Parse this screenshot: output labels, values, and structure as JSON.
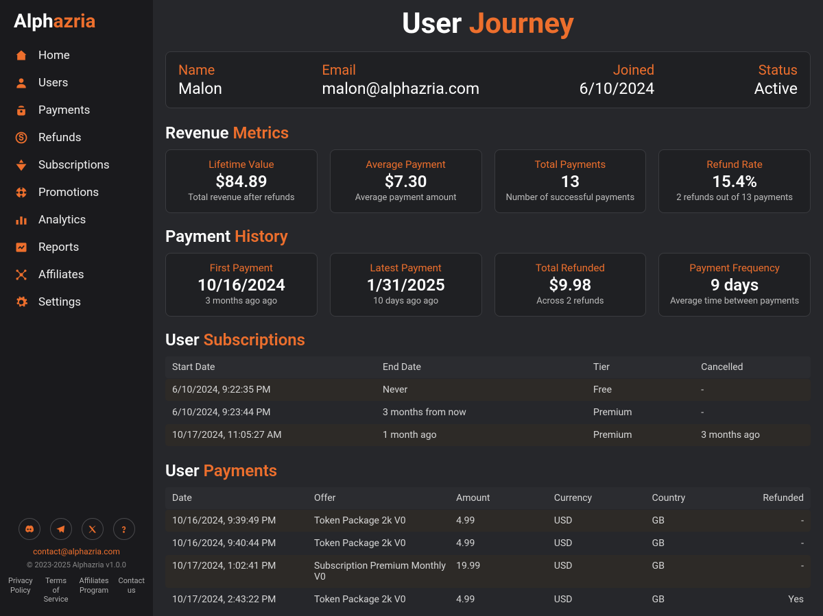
{
  "brand": {
    "part1": "Alph",
    "part2": "azria"
  },
  "sidebar": {
    "items": [
      {
        "label": "Home"
      },
      {
        "label": "Users"
      },
      {
        "label": "Payments"
      },
      {
        "label": "Refunds"
      },
      {
        "label": "Subscriptions"
      },
      {
        "label": "Promotions"
      },
      {
        "label": "Analytics"
      },
      {
        "label": "Reports"
      },
      {
        "label": "Affiliates"
      },
      {
        "label": "Settings"
      }
    ],
    "footer": {
      "contact_email": "contact@alphazria.com",
      "copyright": "© 2023-2025 Alphazria v1.0.0",
      "links": [
        "Privacy Policy",
        "Terms of Service",
        "Affiliates Program",
        "Contact us"
      ]
    }
  },
  "page": {
    "title": {
      "part1": "User ",
      "part2": "Journey"
    }
  },
  "user": {
    "name_label": "Name",
    "name": "Malon",
    "email_label": "Email",
    "email": "malon@alphazria.com",
    "joined_label": "Joined",
    "joined": "6/10/2024",
    "status_label": "Status",
    "status": "Active"
  },
  "sections": {
    "revenue": {
      "part1": "Revenue ",
      "part2": "Metrics"
    },
    "payment_history": {
      "part1": "Payment ",
      "part2": "History"
    },
    "user_subs": {
      "part1": "User ",
      "part2": "Subscriptions"
    },
    "user_payments": {
      "part1": "User ",
      "part2": "Payments"
    }
  },
  "revenue_cards": [
    {
      "label": "Lifetime Value",
      "value": "$84.89",
      "desc": "Total revenue after refunds"
    },
    {
      "label": "Average Payment",
      "value": "$7.30",
      "desc": "Average payment amount"
    },
    {
      "label": "Total Payments",
      "value": "13",
      "desc": "Number of successful payments"
    },
    {
      "label": "Refund Rate",
      "value": "15.4%",
      "desc": "2 refunds out of 13 payments"
    }
  ],
  "history_cards": [
    {
      "label": "First Payment",
      "value": "10/16/2024",
      "desc": "3 months ago ago"
    },
    {
      "label": "Latest Payment",
      "value": "1/31/2025",
      "desc": "10 days ago ago"
    },
    {
      "label": "Total Refunded",
      "value": "$9.98",
      "desc": "Across 2 refunds"
    },
    {
      "label": "Payment Frequency",
      "value": "9 days",
      "desc": "Average time between payments"
    }
  ],
  "subs_table": {
    "headers": [
      "Start Date",
      "End Date",
      "Tier",
      "Cancelled"
    ],
    "rows": [
      [
        "6/10/2024, 9:22:35 PM",
        "Never",
        "Free",
        "-"
      ],
      [
        "6/10/2024, 9:23:44 PM",
        "3 months from now",
        "Premium",
        "-"
      ],
      [
        "10/17/2024, 11:05:27 AM",
        "1 month ago",
        "Premium",
        "3 months ago"
      ]
    ]
  },
  "payments_table": {
    "headers": [
      "Date",
      "Offer",
      "Amount",
      "Currency",
      "Country",
      "Refunded"
    ],
    "rows": [
      [
        "10/16/2024, 9:39:49 PM",
        "Token Package 2k V0",
        "4.99",
        "USD",
        "GB",
        "-"
      ],
      [
        "10/16/2024, 9:40:44 PM",
        "Token Package 2k V0",
        "4.99",
        "USD",
        "GB",
        "-"
      ],
      [
        "10/17/2024, 1:02:41 PM",
        "Subscription Premium Monthly V0",
        "19.99",
        "USD",
        "GB",
        "-"
      ],
      [
        "10/17/2024, 2:43:22 PM",
        "Token Package 2k V0",
        "4.99",
        "USD",
        "GB",
        "Yes"
      ]
    ]
  }
}
